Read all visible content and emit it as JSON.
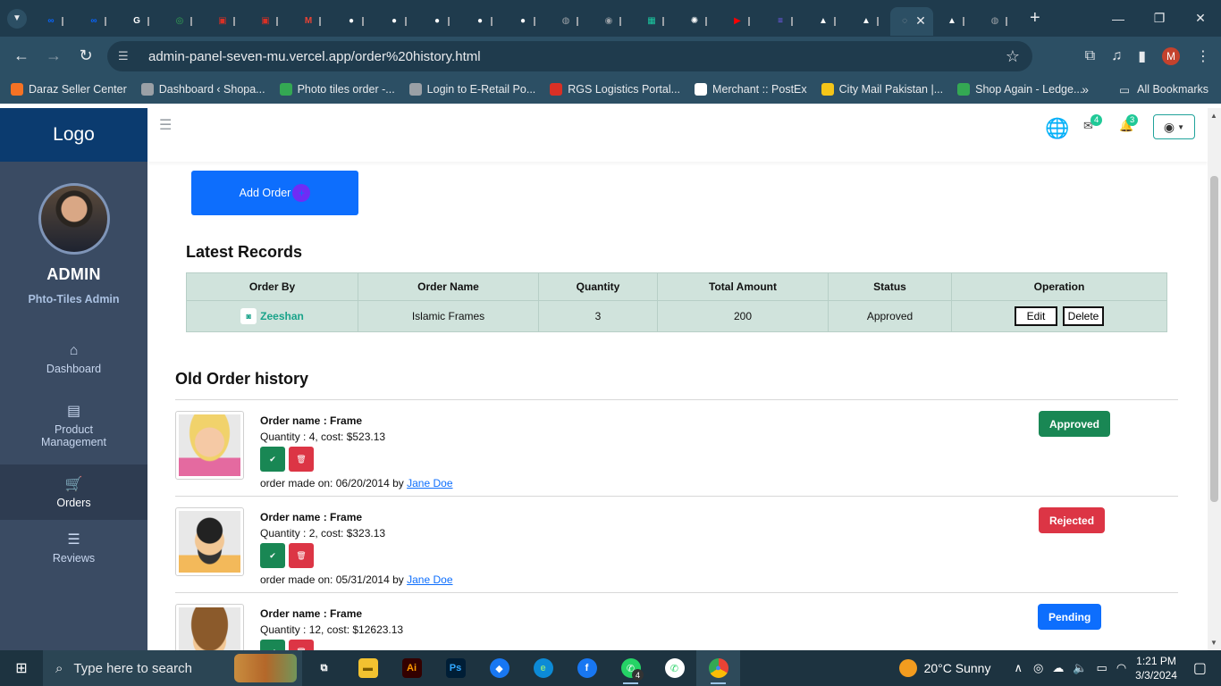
{
  "browser": {
    "tabs": [
      {
        "icon": "meta-icon",
        "color": "#0866ff",
        "glyph": "∞"
      },
      {
        "icon": "meta-icon",
        "color": "#0866ff",
        "glyph": "∞"
      },
      {
        "icon": "google-icon",
        "color": "#ffffff",
        "glyph": "G"
      },
      {
        "icon": "shopify-icon",
        "color": "#34a853",
        "glyph": "◎"
      },
      {
        "icon": "rgs-icon",
        "color": "#d93025",
        "glyph": "▣"
      },
      {
        "icon": "rgs-icon",
        "color": "#d93025",
        "glyph": "▣"
      },
      {
        "icon": "gmail-icon",
        "color": "#ea4335",
        "glyph": "M"
      },
      {
        "icon": "github-icon",
        "color": "#ffffff",
        "glyph": "●"
      },
      {
        "icon": "github-icon",
        "color": "#ffffff",
        "glyph": "●"
      },
      {
        "icon": "github-icon",
        "color": "#ffffff",
        "glyph": "●"
      },
      {
        "icon": "github-icon",
        "color": "#ffffff",
        "glyph": "●"
      },
      {
        "icon": "github-icon",
        "color": "#ffffff",
        "glyph": "●"
      },
      {
        "icon": "globe-icon",
        "color": "#9aa0a6",
        "glyph": "◍"
      },
      {
        "icon": "chrome-icon",
        "color": "#9aa0a6",
        "glyph": "◉"
      },
      {
        "icon": "sheets-icon",
        "color": "#1bc8a0",
        "glyph": "▦"
      },
      {
        "icon": "openai-icon",
        "color": "#ffffff",
        "glyph": "✺"
      },
      {
        "icon": "youtube-icon",
        "color": "#ff0000",
        "glyph": "▶"
      },
      {
        "icon": "list-icon",
        "color": "#7b5cff",
        "glyph": "≡"
      },
      {
        "icon": "vercel-icon",
        "color": "#ffffff",
        "glyph": "▲"
      },
      {
        "icon": "vercel-icon",
        "color": "#ffffff",
        "glyph": "▲"
      },
      {
        "icon": "loading-icon",
        "color": "#9aa0a6",
        "glyph": "◌"
      },
      {
        "icon": "vercel-icon",
        "color": "#ffffff",
        "glyph": "▲"
      },
      {
        "icon": "globe-icon",
        "color": "#9aa0a6",
        "glyph": "◍"
      }
    ],
    "url": "admin-panel-seven-mu.vercel.app/order%20history.html",
    "profile_initial": "M",
    "bookmarks": [
      {
        "label": "Daraz Seller Center",
        "color": "#f57224"
      },
      {
        "label": "Dashboard ‹ Shopa...",
        "color": "#9aa0a6"
      },
      {
        "label": "Photo tiles order -...",
        "color": "#34a853"
      },
      {
        "label": "Login to E-Retail Po...",
        "color": "#9aa0a6"
      },
      {
        "label": "RGS Logistics Portal...",
        "color": "#d93025"
      },
      {
        "label": "Merchant :: PostEx",
        "color": "#ffffff"
      },
      {
        "label": "City Mail Pakistan |...",
        "color": "#f5c518"
      },
      {
        "label": "Shop Again - Ledge...",
        "color": "#34a853"
      }
    ],
    "all_bookmarks": "All Bookmarks"
  },
  "sidebar": {
    "logo": "Logo",
    "admin_name": "ADMIN",
    "admin_subtitle": "Phto-Tiles Admin",
    "items": [
      {
        "label": "Dashboard",
        "icon": "home-icon",
        "glyph": "⌂"
      },
      {
        "label": "Product Management",
        "icon": "clipboard-icon",
        "glyph": "▤"
      },
      {
        "label": "Orders",
        "icon": "cart-icon",
        "glyph": "🛒"
      },
      {
        "label": "Reviews",
        "icon": "list-check-icon",
        "glyph": "☰"
      }
    ]
  },
  "topbar": {
    "mail_count": "4",
    "notif_count": "3"
  },
  "add_order": {
    "label": "Add Order",
    "glyph": "+"
  },
  "latest": {
    "title": "Latest Records",
    "columns": [
      "Order By",
      "Order Name",
      "Quantity",
      "Total Amount",
      "Status",
      "Operation"
    ],
    "rows": [
      {
        "order_by": "Zeeshan",
        "order_name": "Islamic Frames",
        "quantity": "3",
        "total": "200",
        "status": "Approved",
        "edit": "Edit",
        "delete": "Delete"
      }
    ]
  },
  "old_history": {
    "title": "Old Order history",
    "orders": [
      {
        "name": "Order name : Frame",
        "details": "Quantity : 4, cost: $523.13",
        "made_on": "order made on: 06/20/2014 by",
        "by": "Jane Doe",
        "status": "Approved",
        "status_color": "#198754",
        "avatar": "woman-avatar"
      },
      {
        "name": "Order name : Frame",
        "details": "Quantity : 2, cost: $323.13",
        "made_on": "order made on: 05/31/2014 by",
        "by": "Jane Doe",
        "status": "Rejected",
        "status_color": "#dc3545",
        "avatar": "bearded-man-avatar"
      },
      {
        "name": "Order name : Frame",
        "details": "Quantity : 12, cost: $12623.13",
        "made_on": "",
        "by": "",
        "status": "Pending",
        "status_color": "#0d6efd",
        "avatar": "sunglasses-man-avatar"
      }
    ]
  },
  "taskbar": {
    "search_placeholder": "Type here to search",
    "weather": "20°C  Sunny",
    "time": "1:21 PM",
    "date": "3/3/2024",
    "whatsapp_badge": "4"
  }
}
